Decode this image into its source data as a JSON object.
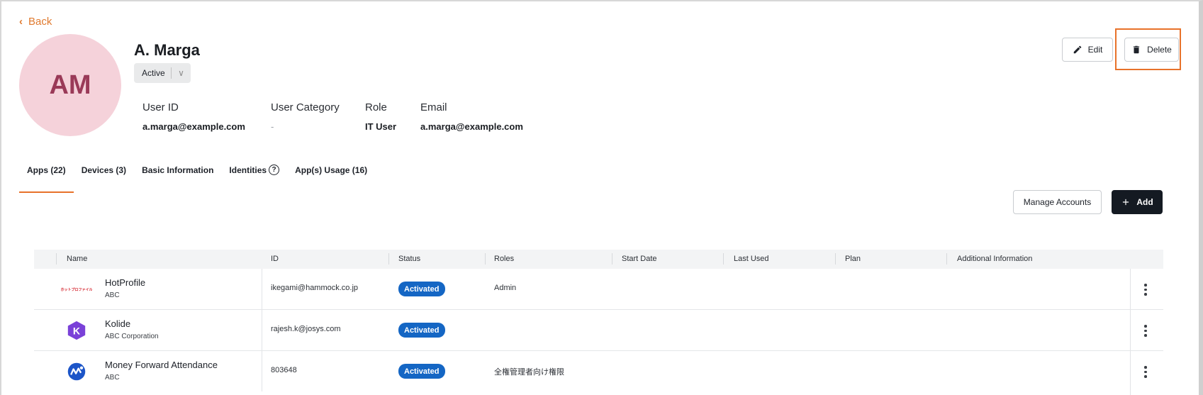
{
  "header": {
    "back_label": "Back",
    "avatar_initials": "AM",
    "user_name": "A. Marga",
    "status": "Active",
    "edit_label": "Edit",
    "delete_label": "Delete"
  },
  "info": {
    "user_id_label": "User ID",
    "user_id": "a.marga@example.com",
    "category_label": "User Category",
    "category": "-",
    "role_label": "Role",
    "role": "IT User",
    "email_label": "Email",
    "email": "a.marga@example.com"
  },
  "tabs": [
    {
      "label": "Apps (22)",
      "active": true
    },
    {
      "label": "Devices (3)",
      "active": false
    },
    {
      "label": "Basic Information",
      "active": false
    },
    {
      "label": "Identities",
      "active": false,
      "icon": "help-circle-icon"
    },
    {
      "label": "App(s) Usage (16)",
      "active": false
    }
  ],
  "actions": {
    "manage_accounts_label": "Manage Accounts",
    "add_label": "Add"
  },
  "table": {
    "columns": [
      "Name",
      "ID",
      "Status",
      "Roles",
      "Start Date",
      "Last Used",
      "Plan",
      "Additional Information"
    ],
    "rows": [
      {
        "name": "HotProfile",
        "org": "ABC",
        "id": "ikegami@hammock.co.jp",
        "status": "Activated",
        "roles": "Admin",
        "logo": "hotprofile-logo",
        "logo_text": "ホットプロファイル"
      },
      {
        "name": "Kolide",
        "org": "ABC Corporation",
        "id": "rajesh.k@josys.com",
        "status": "Activated",
        "roles": "",
        "logo": "kolide-logo"
      },
      {
        "name": "Money Forward Attendance",
        "org": "ABC",
        "id": "803648",
        "status": "Activated",
        "roles": "全権管理者向け権限",
        "logo": "money-forward-logo"
      }
    ]
  },
  "colors": {
    "accent": "#e8722a",
    "badge": "#1466c4",
    "avatar_bg": "#f5d2da",
    "avatar_text": "#9a3a58",
    "primary_button": "#141a22"
  }
}
